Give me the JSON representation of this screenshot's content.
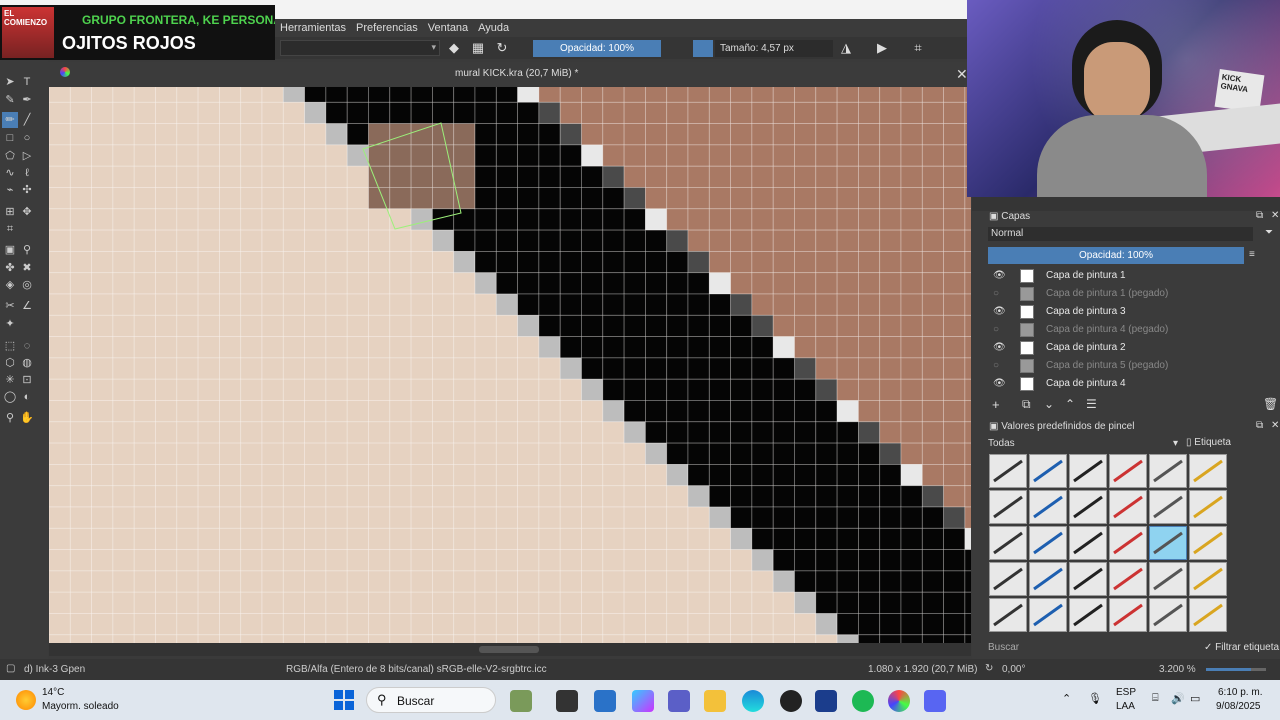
{
  "song": {
    "artist": "GRUPO FRONTERA, KE PERSONAJES",
    "title": "OJITOS ROJOS",
    "art_label": "EL COMIENZO"
  },
  "menu": [
    "Herramientas",
    "Preferencias",
    "Ventana",
    "Ayuda"
  ],
  "tool_options": {
    "opacity": "Opacidad: 100%",
    "size": "Tamaño: 4,57 px"
  },
  "document": {
    "title": "mural KICK.kra (20,7 MiB) *"
  },
  "layers_docker": {
    "title": "Capas",
    "blend_mode": "Normal",
    "opacity": "Opacidad:  100%",
    "layers": [
      {
        "name": "Capa de pintura 1",
        "visible": true
      },
      {
        "name": "Capa de pintura 1 (pegado)",
        "visible": false
      },
      {
        "name": "Capa de pintura 3",
        "visible": true
      },
      {
        "name": "Capa de pintura 4 (pegado)",
        "visible": false
      },
      {
        "name": "Capa de pintura 2",
        "visible": true
      },
      {
        "name": "Capa de pintura 5 (pegado)",
        "visible": false
      },
      {
        "name": "Capa de pintura 4",
        "visible": true
      }
    ]
  },
  "brush_docker": {
    "title": "Valores predefinidos de pincel",
    "filter": "Todas",
    "tag_label": "Etiqueta",
    "search_placeholder": "Buscar",
    "filter_tag_label": "Filtrar etiqueta"
  },
  "status": {
    "brush": "d) Ink-3 Gpen",
    "color": "RGB/Alfa (Entero de 8 bits/canal)  sRGB-elle-V2-srgbtrc.icc",
    "size": "1.080 x 1.920 (20,7 MiB)",
    "rotation": "0,00°",
    "zoom": "3.200 %"
  },
  "taskbar": {
    "temp": "14°C",
    "weather": "Mayorm. soleado",
    "search": "Buscar",
    "lang1": "ESP",
    "lang2": "LAA",
    "time": "6:10 p. m.",
    "date": "9/08/2025"
  },
  "webcam_text": {
    "sign1": "KICK",
    "sign2": "GNAVA"
  },
  "colors": {
    "skin_light": "#e6d2c1",
    "brown": "#a97964",
    "black": "#050505",
    "accent": "#4a7eb5"
  }
}
